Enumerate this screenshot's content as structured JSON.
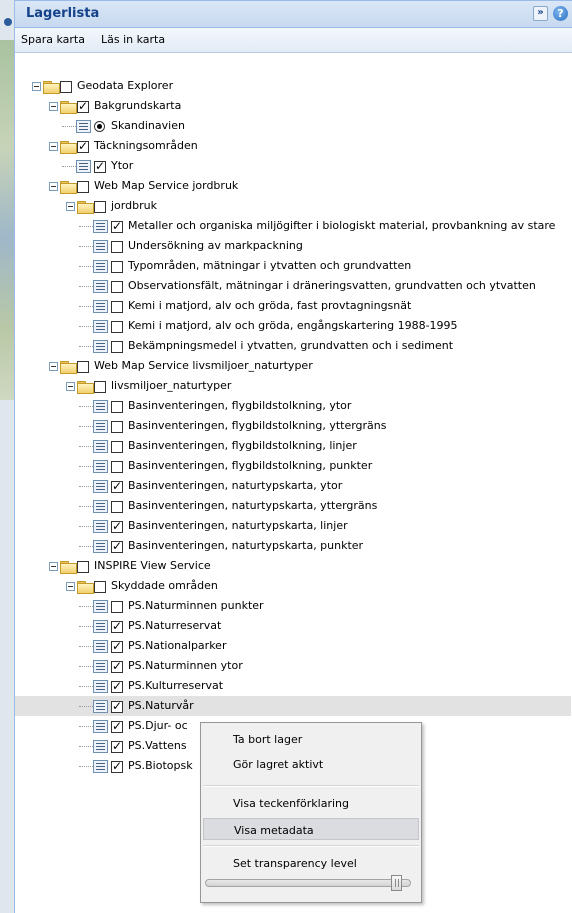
{
  "panel": {
    "title": "Lagerlista",
    "collapse_glyph": "»",
    "help_glyph": "?"
  },
  "toolbar": {
    "save_map": "Spara karta",
    "load_map": "Läs in karta"
  },
  "tree": [
    {
      "level": 0,
      "type": "folder",
      "checked": false,
      "label": "Geodata Explorer"
    },
    {
      "level": 1,
      "type": "folder",
      "checked": true,
      "label": "Bakgrundskarta"
    },
    {
      "level": 2,
      "type": "radio",
      "checked": true,
      "label": "Skandinavien"
    },
    {
      "level": 1,
      "type": "folder",
      "checked": true,
      "label": "Täckningsområden"
    },
    {
      "level": 2,
      "type": "leaf",
      "checked": true,
      "label": "Ytor"
    },
    {
      "level": 1,
      "type": "folder",
      "checked": false,
      "label": "Web Map Service jordbruk"
    },
    {
      "level": 2,
      "type": "folder",
      "checked": false,
      "label": "jordbruk"
    },
    {
      "level": 3,
      "type": "leaf",
      "checked": true,
      "label": "Metaller och organiska miljögifter i biologiskt material, provbankning av stare"
    },
    {
      "level": 3,
      "type": "leaf",
      "checked": false,
      "label": "Undersökning av markpackning"
    },
    {
      "level": 3,
      "type": "leaf",
      "checked": false,
      "label": "Typområden, mätningar i ytvatten och grundvatten"
    },
    {
      "level": 3,
      "type": "leaf",
      "checked": false,
      "label": "Observationsfält, mätningar i dräneringsvatten, grundvatten och ytvatten"
    },
    {
      "level": 3,
      "type": "leaf",
      "checked": false,
      "label": "Kemi i matjord, alv och gröda, fast provtagningsnät"
    },
    {
      "level": 3,
      "type": "leaf",
      "checked": false,
      "label": "Kemi i matjord, alv och gröda, engångskartering 1988-1995"
    },
    {
      "level": 3,
      "type": "leaf",
      "checked": false,
      "label": "Bekämpningsmedel i ytvatten, grundvatten och i sediment"
    },
    {
      "level": 1,
      "type": "folder",
      "checked": false,
      "label": "Web Map Service livsmiljoer_naturtyper"
    },
    {
      "level": 2,
      "type": "folder",
      "checked": false,
      "label": "livsmiljoer_naturtyper"
    },
    {
      "level": 3,
      "type": "leaf",
      "checked": false,
      "label": "Basinventeringen, flygbildstolkning, ytor"
    },
    {
      "level": 3,
      "type": "leaf",
      "checked": false,
      "label": "Basinventeringen, flygbildstolkning, yttergräns"
    },
    {
      "level": 3,
      "type": "leaf",
      "checked": false,
      "label": "Basinventeringen, flygbildstolkning, linjer"
    },
    {
      "level": 3,
      "type": "leaf",
      "checked": false,
      "label": "Basinventeringen, flygbildstolkning, punkter"
    },
    {
      "level": 3,
      "type": "leaf",
      "checked": true,
      "label": "Basinventeringen, naturtypskarta, ytor"
    },
    {
      "level": 3,
      "type": "leaf",
      "checked": false,
      "label": "Basinventeringen, naturtypskarta, yttergräns"
    },
    {
      "level": 3,
      "type": "leaf",
      "checked": true,
      "label": "Basinventeringen, naturtypskarta, linjer"
    },
    {
      "level": 3,
      "type": "leaf",
      "checked": true,
      "label": "Basinventeringen, naturtypskarta, punkter"
    },
    {
      "level": 1,
      "type": "folder",
      "checked": false,
      "label": "INSPIRE View Service"
    },
    {
      "level": 2,
      "type": "folder",
      "checked": false,
      "label": "Skyddade områden"
    },
    {
      "level": 3,
      "type": "leaf",
      "checked": false,
      "label": "PS.Naturminnen punkter"
    },
    {
      "level": 3,
      "type": "leaf",
      "checked": true,
      "label": "PS.Naturreservat"
    },
    {
      "level": 3,
      "type": "leaf",
      "checked": true,
      "label": "PS.Nationalparker"
    },
    {
      "level": 3,
      "type": "leaf",
      "checked": true,
      "label": "PS.Naturminnen ytor"
    },
    {
      "level": 3,
      "type": "leaf",
      "checked": true,
      "label": "PS.Kulturreservat"
    },
    {
      "level": 3,
      "type": "leaf",
      "checked": true,
      "label": "PS.Naturvår",
      "selected": true
    },
    {
      "level": 3,
      "type": "leaf",
      "checked": true,
      "label": "PS.Djur- oc"
    },
    {
      "level": 3,
      "type": "leaf",
      "checked": true,
      "label": "PS.Vattens"
    },
    {
      "level": 3,
      "type": "leaf",
      "checked": true,
      "label": "PS.Biotopsk"
    }
  ],
  "context_menu": {
    "items": [
      "Ta bort lager",
      "Gör lagret aktivt",
      "Visa teckenförklaring",
      "Visa metadata",
      "Set transparency level"
    ],
    "active_item": "Visa metadata",
    "transparency_level": 0.96
  }
}
